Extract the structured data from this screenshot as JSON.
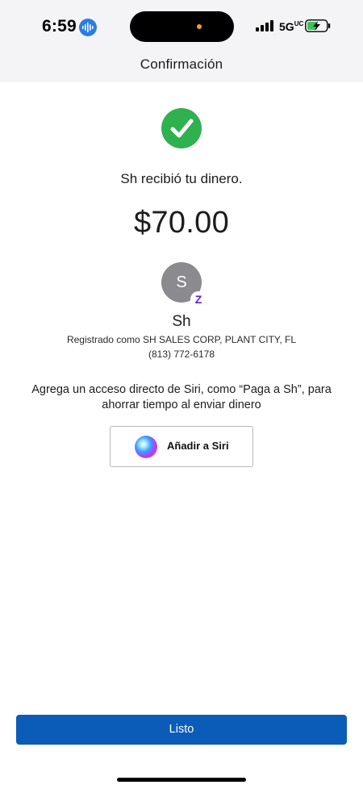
{
  "status_bar": {
    "time": "6:59",
    "network": "5G",
    "network_suffix": "UC",
    "battery_state": "charging"
  },
  "header": {
    "title": "Confirmación"
  },
  "confirmation": {
    "message": "Sh recibió tu dinero.",
    "amount": "$70.00"
  },
  "recipient": {
    "avatar_initial": "S",
    "badge_glyph": "Z",
    "name": "Sh",
    "registered_as": "Registrado como SH SALES CORP, PLANT CITY, FL",
    "phone": "(813) 772-6178"
  },
  "siri": {
    "description": "Agrega un acceso directo de Siri, como “Paga a Sh”, para ahorrar tiempo al enviar dinero",
    "button_label": "Añadir a Siri"
  },
  "footer": {
    "done_label": "Listo"
  },
  "colors": {
    "accent": "#0b5cb8",
    "success": "#2fb14f",
    "zelle": "#6d1ed4",
    "header_bg": "#f4f4f6"
  }
}
